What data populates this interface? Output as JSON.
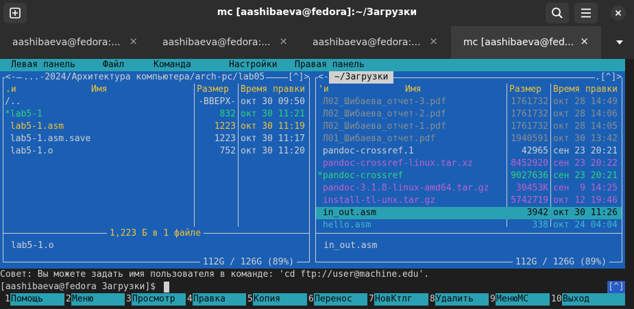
{
  "window": {
    "title": "mc [aashibaeva@fedora]:~/Загрузки"
  },
  "tabs": [
    {
      "label": "aashibaeva@fedora:...",
      "close": "×"
    },
    {
      "label": "aashibaeva@fedora:...",
      "close": "×"
    },
    {
      "label": "aashibaeva@fedora:...",
      "close": "×"
    },
    {
      "label": "mc [aashibaeva@fed...",
      "close": "×"
    }
  ],
  "menu": {
    "left": "Левая панель",
    "file": "Файл",
    "command": "Команда",
    "settings": "Настройки",
    "right": "Правая панель"
  },
  "left_panel": {
    "path": "...-2024/Архитектура компьютера/arch-pc/lab05",
    "indicator": "[^]>",
    "col_sort": ".и",
    "col_name": "Имя",
    "col_size": "Размер",
    "col_time": "Время правки",
    "files": [
      {
        "name": "/..",
        "size": "-ВВЕРХ-",
        "time": "окт 30 09:50",
        "color": "w"
      },
      {
        "name": "*lab5-1",
        "size": "832",
        "time": "окт 30 11:21",
        "color": "g"
      },
      {
        "name": " lab5-1.asm",
        "size": "1223",
        "time": "окт 30 11:19",
        "color": "y"
      },
      {
        "name": " lab5-1.asm.save",
        "size": "1223",
        "time": "окт 30 11:17",
        "color": "w"
      },
      {
        "name": " lab5-1.o",
        "size": "752",
        "time": "окт 30 11:20",
        "color": "w"
      }
    ],
    "summary": "1,223 Б в 1 файле",
    "mini_status": "lab5-1.o",
    "disk": "112G / 126G (89%)"
  },
  "right_panel": {
    "path": "~/Загрузки",
    "indicator": ".[^]>",
    "col_sort": "'и",
    "col_name": "Имя",
    "col_size": "Размер",
    "col_time": "Время правки",
    "files": [
      {
        "name": " Л02_Шибаева_отчет-3.pdf",
        "size": "1761732",
        "time": "окт 28 14:49",
        "color": "gr"
      },
      {
        "name": " Л02_Шибаева_отчет-2.pdf",
        "size": "1761732",
        "time": "окт 28 14:06",
        "color": "gr"
      },
      {
        "name": " Л02_Шибаева_отчет-1.pdf",
        "size": "1761732",
        "time": "окт 28 14:05",
        "color": "gr"
      },
      {
        "name": " Л01_Шибаева_отчет.pdf",
        "size": "1940591",
        "time": "окт 30 13:42",
        "color": "gr"
      },
      {
        "name": " pandoc-crossref.1",
        "size": "42965",
        "time": "сен 23 20:21",
        "color": "w"
      },
      {
        "name": " pandoc-crossref-linux.tar.xz",
        "size": "8452920",
        "time": "сен 23 20:22",
        "color": "m"
      },
      {
        "name": "*pandoc-crossref",
        "size": "9027636",
        "time": "сен 23 20:21",
        "color": "g"
      },
      {
        "name": " pandoc-3.1.8-linux-amd64.tar.gz",
        "size": "30453K",
        "time": "сен  9 14:25",
        "color": "m"
      },
      {
        "name": " install-tl-unx.tar.gz",
        "size": "5742719",
        "time": "окт 12 19:46",
        "color": "m"
      },
      {
        "name": " in_out.asm",
        "size": "3942",
        "time": "окт 30 11:26",
        "color": "k",
        "selected": true
      },
      {
        "name": " hello.asm",
        "size": "338",
        "time": "окт 24 04:04",
        "color": "c"
      }
    ],
    "mini_status": "in_out.asm",
    "disk": "112G / 126G (89%)"
  },
  "hint": "Совет: Вы можете задать имя пользователя в команде: 'cd ftp://user@machine.edu'.",
  "prompt": "[aashibaeva@fedora Загрузки]$",
  "hint_indicator": "[^]",
  "keys": [
    {
      "num": "1",
      "label": "Помощь"
    },
    {
      "num": "2",
      "label": "Меню"
    },
    {
      "num": "3",
      "label": "Просмотр"
    },
    {
      "num": "4",
      "label": "Правка"
    },
    {
      "num": "5",
      "label": "Копия"
    },
    {
      "num": "6",
      "label": "Перенос"
    },
    {
      "num": "7",
      "label": "НовКтлг"
    },
    {
      "num": "8",
      "label": "Удалить"
    },
    {
      "num": "9",
      "label": "МенюМС"
    },
    {
      "num": "10",
      "label": "Выход"
    }
  ]
}
